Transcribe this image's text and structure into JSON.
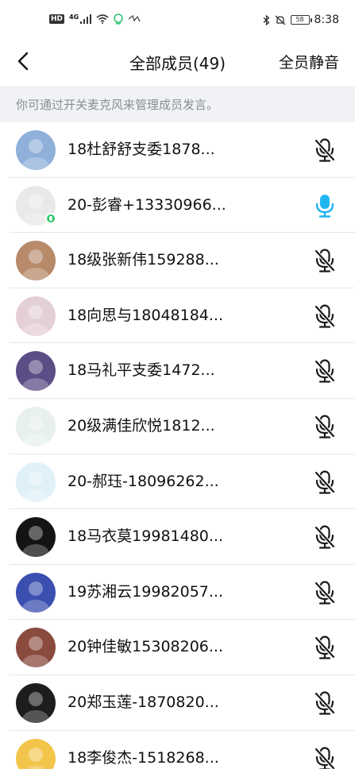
{
  "status_bar": {
    "hd_badge": "HD",
    "network": "4G",
    "battery": "58",
    "time": "8:38"
  },
  "header": {
    "title": "全部成员(49)",
    "mute_all": "全员静音"
  },
  "tip": "你可通过开关麦克风来管理成员发言。",
  "members": [
    {
      "name": "18杜舒舒支委1878...",
      "mic": "muted",
      "avatar_color": "#8fb0d8"
    },
    {
      "name": "20-彭睿+13330966...",
      "mic": "active",
      "avatar_color": "#e9e9e9",
      "speaking": true
    },
    {
      "name": "18级张新伟159288...",
      "mic": "muted",
      "avatar_color": "#b78a6a"
    },
    {
      "name": "18向思与18048184...",
      "mic": "muted",
      "avatar_color": "#e4cfd6"
    },
    {
      "name": "18马礼平支委1472...",
      "mic": "muted",
      "avatar_color": "#5b4e86"
    },
    {
      "name": "20级满佳欣悦1812...",
      "mic": "muted",
      "avatar_color": "#e8f0ec"
    },
    {
      "name": "20-郝珏-18096262...",
      "mic": "muted",
      "avatar_color": "#dff0f7"
    },
    {
      "name": "18马衣莫19981480...",
      "mic": "muted",
      "avatar_color": "#141414"
    },
    {
      "name": "19苏湘云19982057...",
      "mic": "muted",
      "avatar_color": "#3b4fb0"
    },
    {
      "name": "20钟佳敏15308206...",
      "mic": "muted",
      "avatar_color": "#8a4a3e"
    },
    {
      "name": "20郑玉莲-1870820...",
      "mic": "muted",
      "avatar_color": "#1d1d1f"
    },
    {
      "name": "18李俊杰-1518268...",
      "mic": "muted",
      "avatar_color": "#f2c54a"
    }
  ],
  "colors": {
    "mic_active": "#21b6f0",
    "mic_muted": "#1a1a1a",
    "tip_bg": "#f1f2f6"
  }
}
